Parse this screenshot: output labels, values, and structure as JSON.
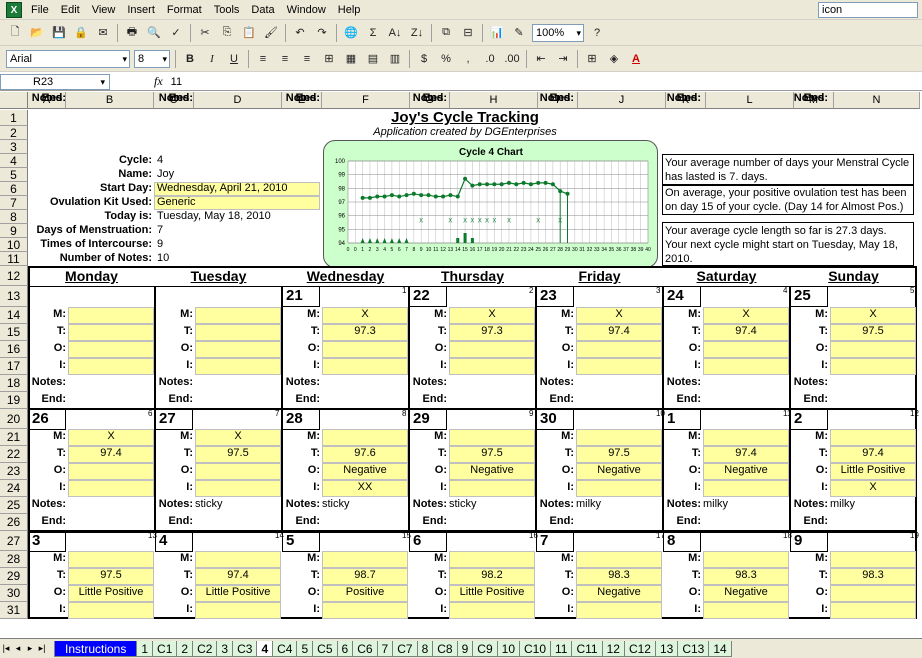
{
  "menu": [
    "File",
    "Edit",
    "View",
    "Insert",
    "Format",
    "Tools",
    "Data",
    "Window",
    "Help"
  ],
  "help_box": "icon",
  "toolbar": {
    "zoom": "100%",
    "font": "Arial",
    "size": "8"
  },
  "formula": {
    "cell": "R23",
    "value": "11"
  },
  "columns": [
    "A",
    "B",
    "C",
    "D",
    "E",
    "F",
    "G",
    "H",
    "I",
    "J",
    "K",
    "L",
    "M",
    "N"
  ],
  "rows": [
    "1",
    "2",
    "3",
    "4",
    "5",
    "6",
    "7",
    "8",
    "9",
    "10",
    "11",
    "12",
    "13",
    "14",
    "15",
    "16",
    "17",
    "18",
    "19",
    "20",
    "21",
    "22",
    "23",
    "24",
    "25",
    "26",
    "27",
    "28",
    "29",
    "30",
    "31"
  ],
  "title": "Joy's Cycle Tracking",
  "subtitle": "Application created by DGEnterprises",
  "info_labels": [
    "Cycle:",
    "Name:",
    "Start Day:",
    "Ovulation Kit Used:",
    "Today is:",
    "Days of Menstruation:",
    "Times of Intercourse:",
    "Number of Notes:"
  ],
  "info_values": [
    "4",
    "Joy",
    "Wednesday, April 21, 2010",
    "Generic",
    "Tuesday, May 18, 2010",
    "7",
    "9",
    "10"
  ],
  "notes": [
    "Your average number of days your Menstral Cycle has lasted is 7. days.",
    "On average, your positive ovulation test has been on day 15 of your cycle.  (Day 14 for Almost Pos.)",
    "Your average cycle length so far is 27.3 days.  Your next cycle might start on Tuesday, May 18, 2010."
  ],
  "weekdays": [
    "Monday",
    "Tuesday",
    "Wednesday",
    "Thursday",
    "Friday",
    "Saturday",
    "Sunday"
  ],
  "labels": {
    "m": "M:",
    "t": "T:",
    "o": "O:",
    "i": "I:",
    "notes": "Notes:",
    "end": "End:"
  },
  "weeks": [
    {
      "days": [
        {
          "date": "",
          "num": ""
        },
        {
          "date": "",
          "num": ""
        },
        {
          "date": "21",
          "num": "1",
          "m": "X",
          "t": "97.3"
        },
        {
          "date": "22",
          "num": "2",
          "m": "X",
          "t": "97.3"
        },
        {
          "date": "23",
          "num": "3",
          "m": "X",
          "t": "97.4"
        },
        {
          "date": "24",
          "num": "4",
          "m": "X",
          "t": "97.4"
        },
        {
          "date": "25",
          "num": "5",
          "m": "X",
          "t": "97.5"
        }
      ]
    },
    {
      "days": [
        {
          "date": "26",
          "num": "6",
          "m": "X",
          "t": "97.4"
        },
        {
          "date": "27",
          "num": "7",
          "m": "X",
          "t": "97.5",
          "notes": "sticky"
        },
        {
          "date": "28",
          "num": "8",
          "t": "97.6",
          "o": "Negative",
          "i": "XX",
          "notes": "sticky"
        },
        {
          "date": "29",
          "num": "9",
          "t": "97.5",
          "o": "Negative",
          "notes": "sticky"
        },
        {
          "date": "30",
          "num": "10",
          "t": "97.5",
          "o": "Negative",
          "notes": "milky"
        },
        {
          "date": "1",
          "num": "11",
          "t": "97.4",
          "o": "Negative",
          "notes": "milky"
        },
        {
          "date": "2",
          "num": "12",
          "t": "97.4",
          "o": "Little Positive",
          "i": "X",
          "notes": "milky"
        }
      ]
    },
    {
      "days": [
        {
          "date": "3",
          "num": "13",
          "t": "97.5",
          "o": "Little Positive"
        },
        {
          "date": "4",
          "num": "14",
          "t": "97.4",
          "o": "Little Positive"
        },
        {
          "date": "5",
          "num": "15",
          "t": "98.7",
          "o": "Positive"
        },
        {
          "date": "6",
          "num": "16",
          "t": "98.2",
          "o": "Little Positive"
        },
        {
          "date": "7",
          "num": "17",
          "t": "98.3",
          "o": "Negative"
        },
        {
          "date": "8",
          "num": "18",
          "t": "98.3",
          "o": "Negative"
        },
        {
          "date": "9",
          "num": "19",
          "t": "98.3"
        }
      ]
    }
  ],
  "tabs": [
    "Instructions",
    "1",
    "C1",
    "2",
    "C2",
    "3",
    "C3",
    "4",
    "C4",
    "5",
    "C5",
    "6",
    "C6",
    "7",
    "C7",
    "8",
    "C8",
    "9",
    "C9",
    "10",
    "C10",
    "11",
    "C11",
    "12",
    "C12",
    "13",
    "C13",
    "14"
  ],
  "active_tab": "4",
  "chart_data": {
    "type": "line",
    "title": "Cycle 4 Chart",
    "y_ticks": [
      "100",
      "99",
      "98",
      "97",
      "96",
      "95",
      "94"
    ],
    "ylim": [
      94,
      100
    ],
    "x_ticks": [
      "0",
      "0",
      "1",
      "2",
      "3",
      "4",
      "5",
      "6",
      "7",
      "8",
      "9",
      "10",
      "11",
      "12",
      "13",
      "14",
      "15",
      "16",
      "17",
      "18",
      "19",
      "20",
      "21",
      "22",
      "23",
      "24",
      "25",
      "26",
      "27",
      "28",
      "29",
      "30",
      "31",
      "32",
      "33",
      "34",
      "35",
      "36",
      "37",
      "38",
      "39",
      "40"
    ],
    "temps": [
      97.3,
      97.3,
      97.4,
      97.4,
      97.5,
      97.4,
      97.5,
      97.6,
      97.5,
      97.5,
      97.4,
      97.4,
      97.5,
      97.4,
      98.7,
      98.2,
      98.3,
      98.3,
      98.3,
      98.3,
      98.4,
      98.3,
      98.4,
      98.3,
      98.4,
      98.4,
      98.3,
      97.8,
      97.6
    ],
    "markers": [
      "X",
      "X",
      "X",
      "X",
      "X",
      "X",
      "X",
      "X",
      "X",
      "X"
    ]
  }
}
